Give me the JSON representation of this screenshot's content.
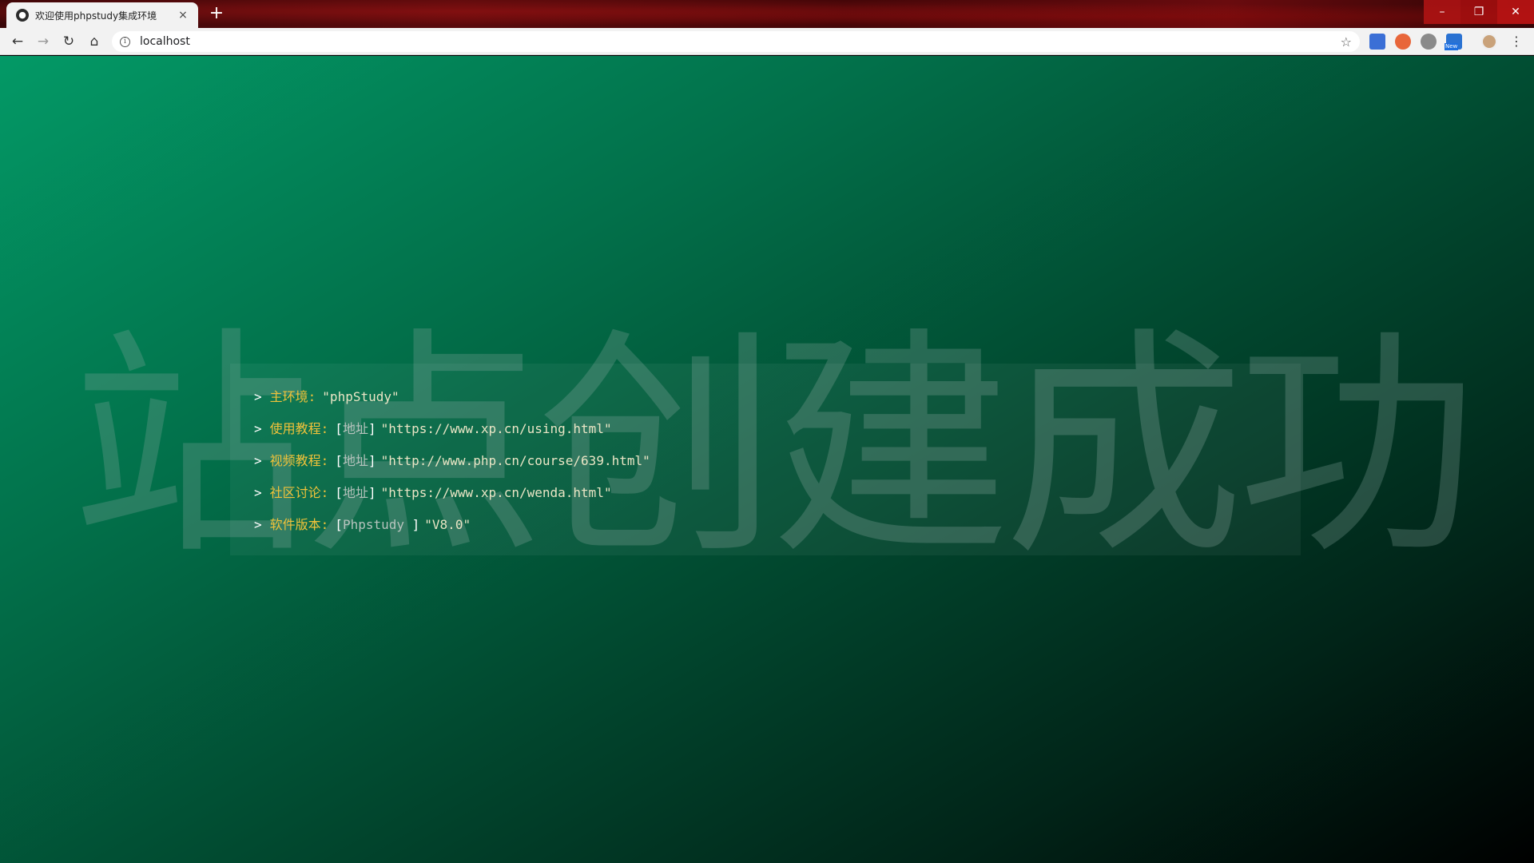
{
  "browser": {
    "tab_title": "欢迎使用phpstudy集成环境",
    "tab_close": "×",
    "new_tab": "+",
    "url": "localhost",
    "window_controls": {
      "minimize": "–",
      "maximize": "❐",
      "close": "✕"
    },
    "extensions": [
      {
        "name": "translate-extension-icon",
        "label": ""
      },
      {
        "name": "ext-orange-icon",
        "label": ""
      },
      {
        "name": "ext-gray-icon",
        "label": ""
      },
      {
        "name": "ext-new-icon",
        "label": "New"
      }
    ]
  },
  "page": {
    "watermark": "站点创建成功",
    "rows": [
      {
        "label": "主环境",
        "link": "",
        "value": "\"phpStudy\""
      },
      {
        "label": "使用教程",
        "link": "地址",
        "value": "\"https://www.xp.cn/using.html\""
      },
      {
        "label": "视频教程",
        "link": "地址",
        "value": "\"http://www.php.cn/course/639.html\""
      },
      {
        "label": "社区讨论",
        "link": "地址",
        "value": "\"https://www.xp.cn/wenda.html\""
      },
      {
        "label": "软件版本",
        "link": "Phpstudy ",
        "value": "\"V8.0\""
      }
    ],
    "prompt": ">"
  }
}
